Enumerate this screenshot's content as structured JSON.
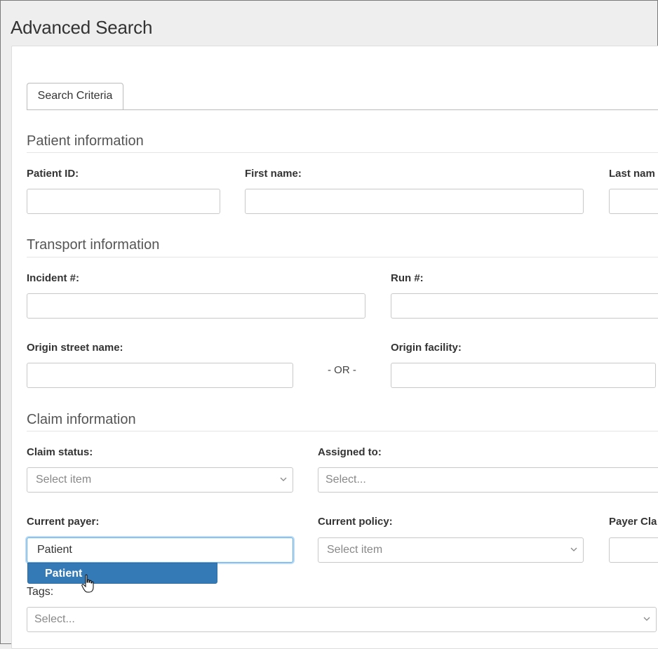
{
  "page": {
    "title": "Advanced Search"
  },
  "tabs": [
    {
      "label": "Search Criteria"
    }
  ],
  "sections": {
    "patient": {
      "title": "Patient information",
      "patient_id_label": "Patient ID:",
      "first_name_label": "First name:",
      "last_name_label": "Last nam"
    },
    "transport": {
      "title": "Transport information",
      "incident_label": "Incident #:",
      "run_label": "Run #:",
      "origin_street_label": "Origin street name:",
      "or_text": "- OR -",
      "origin_facility_label": "Origin facility:"
    },
    "claim": {
      "title": "Claim information",
      "claim_status_label": "Claim status:",
      "claim_status_placeholder": "Select item",
      "assigned_to_label": "Assigned to:",
      "assigned_to_placeholder": "Select...",
      "current_payer_label": "Current payer:",
      "current_payer_value": "Patient",
      "current_policy_label": "Current policy:",
      "current_policy_placeholder": "Select item",
      "payer_class_label": "Payer Cla",
      "tags_label": "Tags:",
      "tags_placeholder": "Select..."
    }
  },
  "autocomplete": {
    "options": [
      "Patient"
    ],
    "highlighted_index": 0
  },
  "colors": {
    "accent": "#337ab7",
    "focus": "#66afe9"
  },
  "icons": {
    "chevron": "chevron-down-icon",
    "cursor": "hand-pointer-icon"
  }
}
